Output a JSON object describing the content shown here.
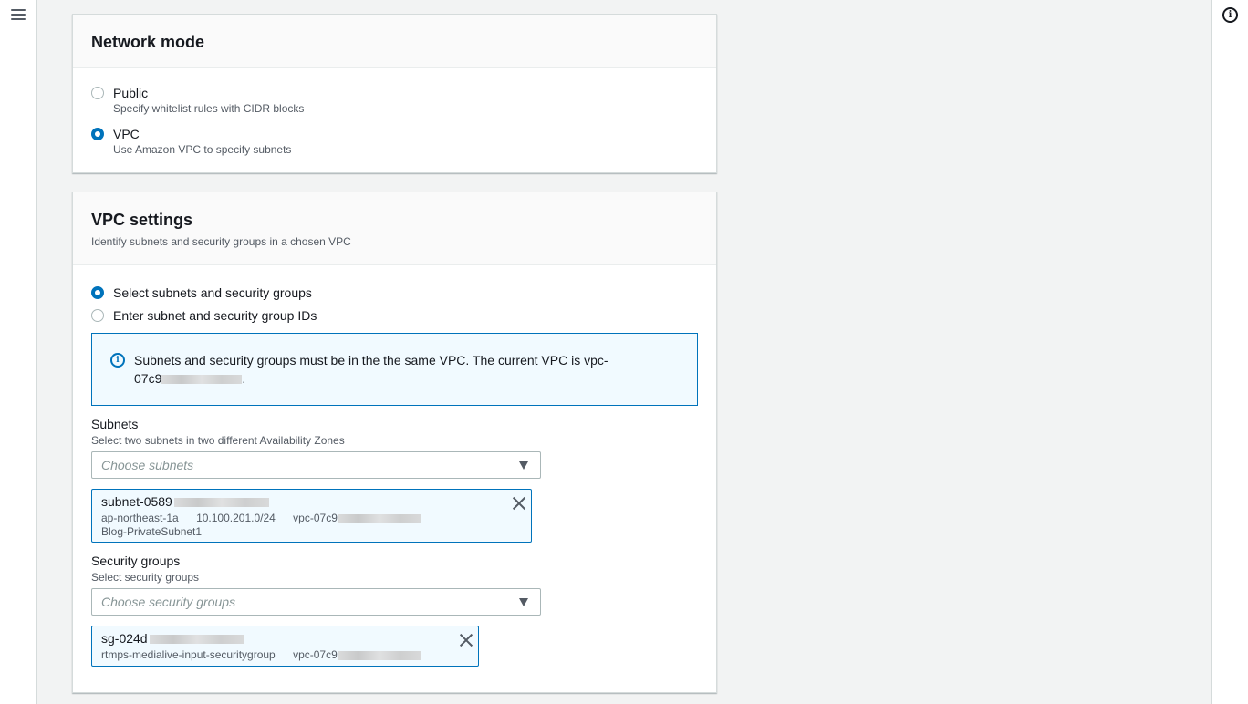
{
  "network_mode": {
    "title": "Network mode",
    "options": [
      {
        "label": "Public",
        "description": "Specify whitelist rules with CIDR blocks",
        "selected": false
      },
      {
        "label": "VPC",
        "description": "Use Amazon VPC to specify subnets",
        "selected": true
      }
    ]
  },
  "vpc_settings": {
    "title": "VPC settings",
    "description": "Identify subnets and security groups in a chosen VPC",
    "options": [
      {
        "label": "Select subnets and security groups",
        "selected": true
      },
      {
        "label": "Enter subnet and security group IDs",
        "selected": false
      }
    ],
    "info": {
      "line1": "Subnets and security groups must be in the the same VPC. The current VPC is vpc-",
      "line2_prefix": "07c9",
      "line2_suffix": "."
    },
    "subnets": {
      "label": "Subnets",
      "description": "Select two subnets in two different Availability Zones",
      "placeholder": "Choose subnets",
      "selected": {
        "id": "subnet-0589",
        "az": "ap-northeast-1a",
        "cidr": "10.100.201.0/24",
        "vpc": "vpc-07c9",
        "name": "Blog-PrivateSubnet1"
      }
    },
    "security_groups": {
      "label": "Security groups",
      "description": "Select security groups",
      "placeholder": "Choose security groups",
      "selected": {
        "id": "sg-024d",
        "name": "rtmps-medialive-input-securitygroup",
        "vpc": "vpc-07c9"
      }
    }
  },
  "colors": {
    "accent": "#0073bb",
    "panel_header_bg": "#fafafa",
    "page_bg": "#f2f3f3",
    "token_bg": "#f1faff"
  },
  "icons": {
    "menu": "hamburger-menu-icon",
    "info": "info-icon",
    "dropdown": "caret-down-icon",
    "dismiss": "close-icon"
  }
}
